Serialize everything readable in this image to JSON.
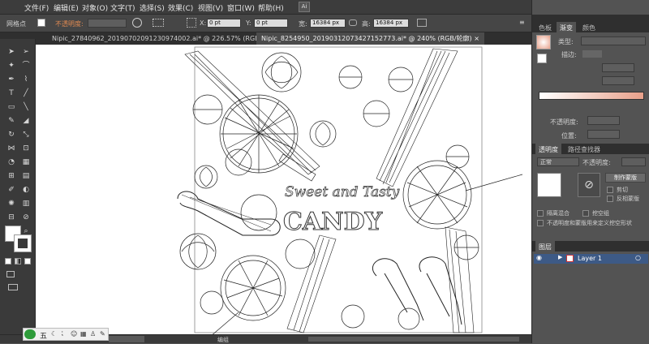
{
  "menubar": {
    "items": [
      "文件(F)",
      "编辑(E)",
      "对象(O)",
      "文字(T)",
      "选择(S)",
      "效果(C)",
      "视图(V)",
      "窗口(W)",
      "帮助(H)"
    ],
    "app_mode": "Ai"
  },
  "control": {
    "selection_label": "网格点",
    "opacity_label": "不透明度:",
    "x_value": "0 pt",
    "y_value": "0 pt",
    "w_value": "16384 px",
    "h_value": "16384 px",
    "accent": "#e08a52"
  },
  "tabs": [
    {
      "label": "Nipic_27840962_20190702091230974002.ai* @ 226.57% (RGB/预览)",
      "active": false
    },
    {
      "label": "Nipic_8254950_20190312073427152773.ai* @ 240% (RGB/轮廓)",
      "active": true
    }
  ],
  "artwork": {
    "headline": "Sweet and Tasty",
    "title": "CANDY"
  },
  "status": {
    "mode": "编组"
  },
  "panels": {
    "color_tabs": [
      "色板",
      "渐变",
      "颜色"
    ],
    "gradient": {
      "type_label": "类型:",
      "stroke_label": "描边:",
      "opacity_label": "不透明度:",
      "position_label": "位置:",
      "gradient_start": "#ffffff",
      "gradient_end": "#e8a08a"
    },
    "transparency_tabs": [
      "透明度",
      "路径查找器"
    ],
    "transparency": {
      "blend_mode": "正常",
      "opacity_label": "不透明度:",
      "make_mask": "制作蒙版",
      "clip": "剪切",
      "invert_mask": "反相蒙版",
      "isolate_blending": "隔离混合",
      "knockout_group": "挖空组",
      "define_knockout": "不透明度和蒙版用来定义挖空形状"
    },
    "layers_tab": "图层",
    "layers": [
      {
        "name": "Layer 1"
      }
    ]
  },
  "ime": {
    "label": "五"
  }
}
